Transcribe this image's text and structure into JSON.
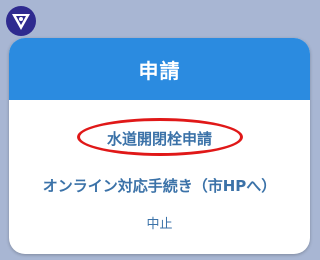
{
  "app": {
    "logo_icon": "city-emblem-icon",
    "logo_color": "#2e2a8f"
  },
  "dialog": {
    "title": "申請",
    "header_color": "#2b8be0",
    "options": [
      {
        "label": "水道開閉栓申請",
        "highlighted": true
      },
      {
        "label": "オンライン対応手続き（市HPへ）"
      }
    ],
    "cancel_label": "中止"
  },
  "colors": {
    "background": "#a8b6d3",
    "link_text": "#3b72a8",
    "highlight": "#e01818"
  }
}
